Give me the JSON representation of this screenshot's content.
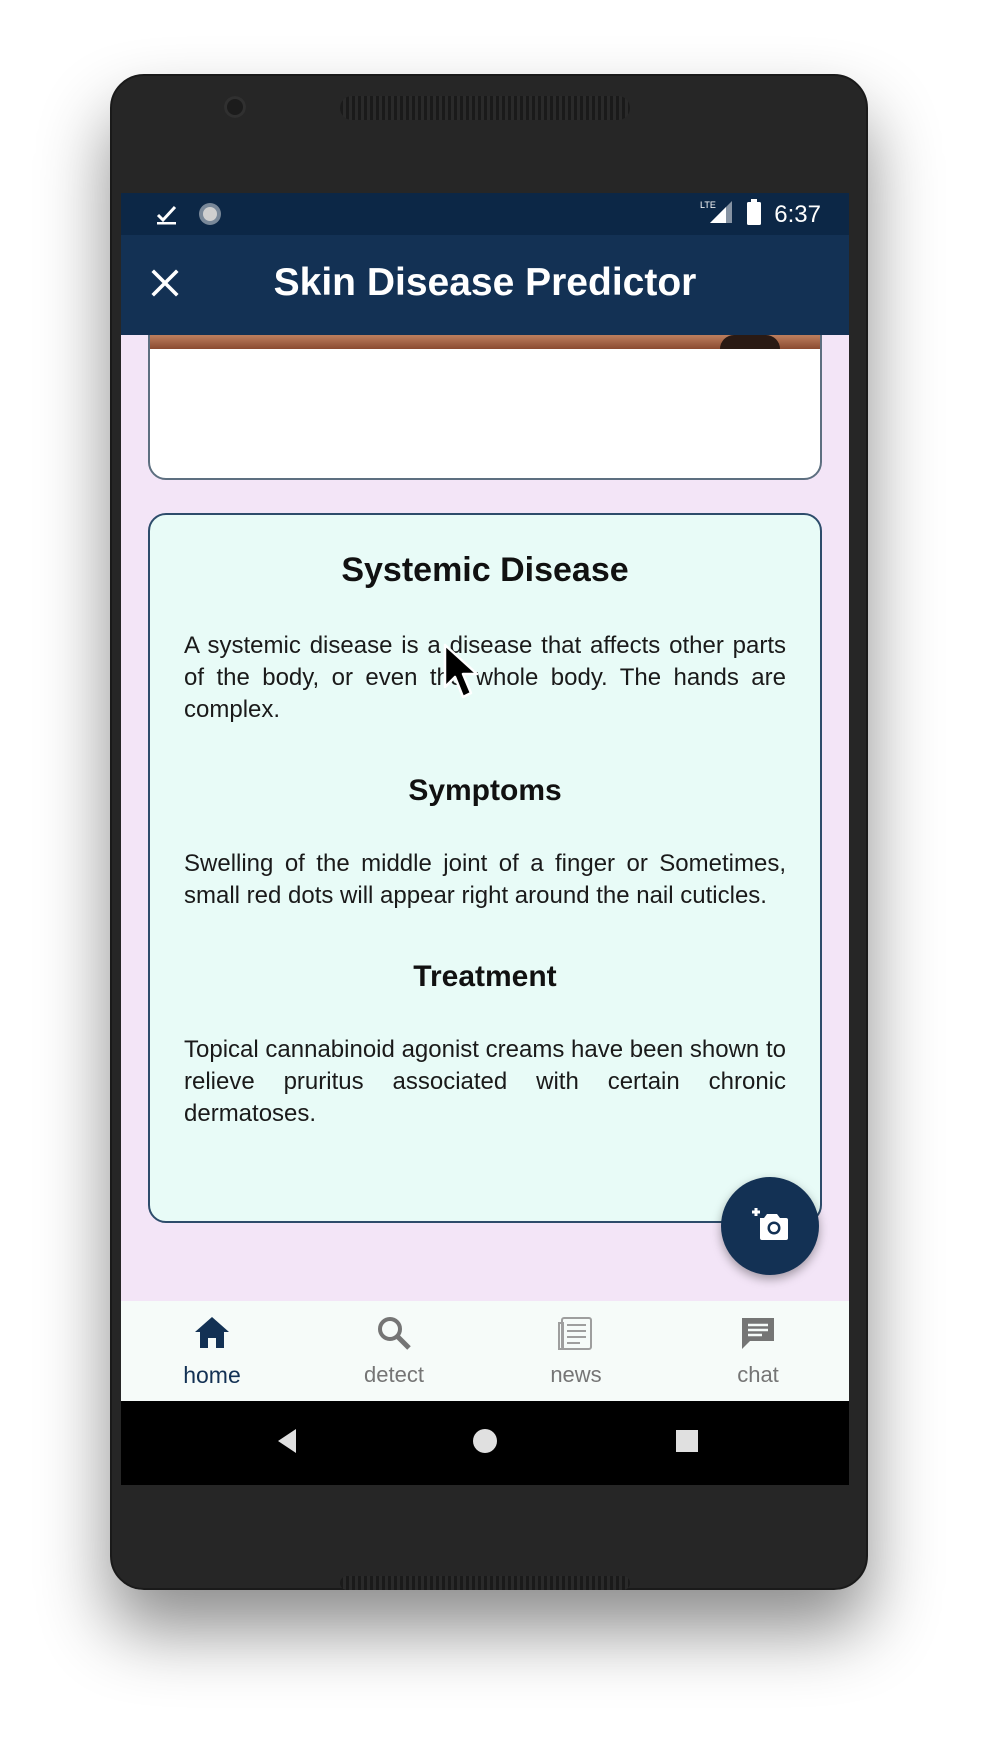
{
  "status_bar": {
    "time": "6:37",
    "network_label": "LTE"
  },
  "app_bar": {
    "title": "Skin Disease Predictor",
    "close_icon": "close-icon"
  },
  "info": {
    "title": "Systemic Disease",
    "description": "A systemic disease is a disease that affects other parts of the body, or even the whole body. The hands are complex.",
    "symptoms_heading": "Symptoms",
    "symptoms": "Swelling of the middle joint of a finger or Sometimes, small red dots will appear right around the nail cuticles.",
    "treatment_heading": "Treatment",
    "treatment": "Topical cannabinoid agonist creams have been shown to relieve pruritus associated with certain chronic dermatoses."
  },
  "fab": {
    "icon": "add-photo-icon"
  },
  "bottom_nav": {
    "items": [
      {
        "label": "home",
        "icon": "home-icon",
        "active": true
      },
      {
        "label": "detect",
        "icon": "search-icon",
        "active": false
      },
      {
        "label": "news",
        "icon": "newspaper-icon",
        "active": false
      },
      {
        "label": "chat",
        "icon": "chat-icon",
        "active": false
      }
    ]
  },
  "colors": {
    "primary": "#133154",
    "status_bar": "#0c2746",
    "background": "#f3e5f7",
    "card_background": "#e8fbf7",
    "nav_inactive": "#757575"
  }
}
